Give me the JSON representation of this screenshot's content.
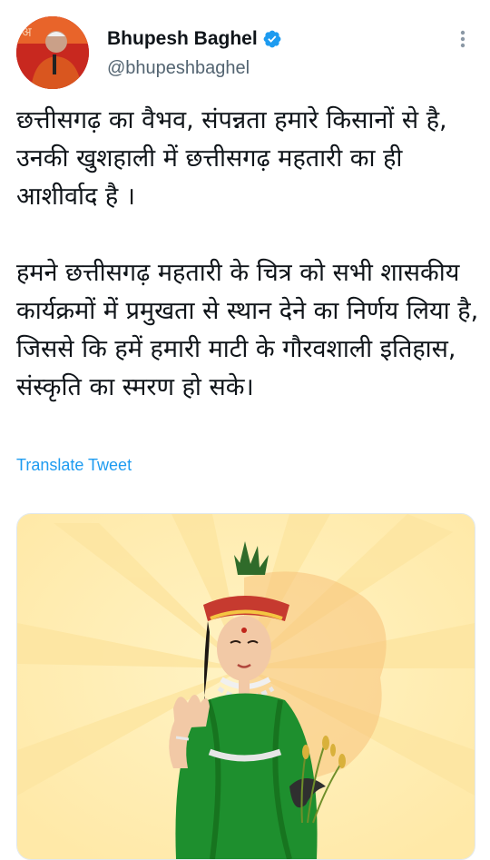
{
  "author": {
    "display_name": "Bhupesh Baghel",
    "handle": "@bhupeshbaghel",
    "verified": true,
    "avatar_icon": "avatar",
    "verified_icon": "verified-badge-icon",
    "more_icon": "more-options-icon"
  },
  "tweet": {
    "paragraphs": [
      "छत्तीसगढ़ का वैभव, संपन्नता हमारे किसानों से है, उनकी खुशहाली में छत्तीसगढ़ महतारी का ही आशीर्वाद है ।",
      "हमने छत्तीसगढ़ महतारी के चित्र को सभी शासकीय कार्यक्रमों में प्रमुखता से स्थान देने का निर्णय लिया है, जिससे कि हमें हमारी माटी के गौरवशाली इतिहास, संस्कृति का स्मरण हो सके।"
    ],
    "translate_label": "Translate Tweet"
  },
  "colors": {
    "accent": "#1d9bf0",
    "secondary_text": "#536471",
    "saree_green": "#1e8f2e"
  }
}
